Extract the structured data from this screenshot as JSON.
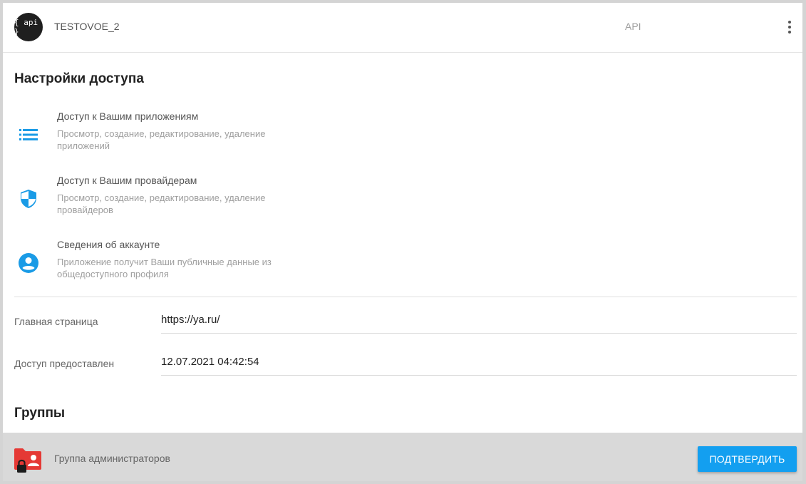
{
  "header": {
    "logo_text": "{ api }",
    "app_name": "TESTOVOE_2",
    "api_label": "API"
  },
  "access": {
    "title": "Настройки доступа",
    "permissions": [
      {
        "icon": "list-icon",
        "title": "Доступ к Вашим приложениям",
        "description": "Просмотр, создание, редактирование, удаление приложений"
      },
      {
        "icon": "shield-icon",
        "title": "Доступ к Вашим провайдерам",
        "description": "Просмотр, создание, редактирование, удаление провайдеров"
      },
      {
        "icon": "account-circle-icon",
        "title": "Сведения об аккаунте",
        "description": "Приложение получит Ваши публичные данные из общедоступного профиля"
      }
    ]
  },
  "fields": {
    "homepage": {
      "label": "Главная страница",
      "value": "https://ya.ru/"
    },
    "granted": {
      "label": "Доступ предоставлен",
      "value": "12.07.2021 04:42:54"
    }
  },
  "groups": {
    "title": "Группы",
    "items": [
      {
        "icon": "locked-folder-user-icon",
        "name": "Группа администраторов"
      }
    ]
  },
  "actions": {
    "confirm_label": "ПОДТВЕРДИТЬ"
  },
  "colors": {
    "accent": "#139ff0",
    "icon_blue": "#1a9be6",
    "folder_red": "#e53935"
  }
}
